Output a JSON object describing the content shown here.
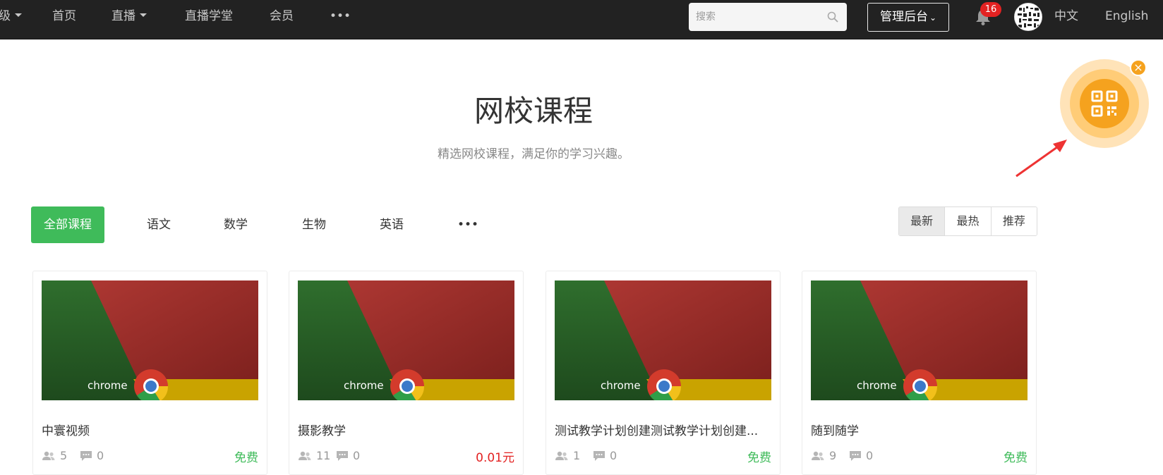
{
  "nav": {
    "partial_label": "级",
    "items": [
      {
        "label": "首页"
      },
      {
        "label": "直播"
      },
      {
        "label": "直播学堂"
      },
      {
        "label": "会员"
      },
      {
        "label": "•••"
      }
    ],
    "search": {
      "placeholder": "搜索",
      "value": ""
    },
    "admin_label": "管理后台",
    "notification_count": "16",
    "lang_zh": "中文",
    "lang_en": "English"
  },
  "header": {
    "title": "网校课程",
    "subtitle": "精选网校课程，满足你的学习兴趣。"
  },
  "categories": [
    {
      "label": "全部课程"
    },
    {
      "label": "语文"
    },
    {
      "label": "数学"
    },
    {
      "label": "生物"
    },
    {
      "label": "英语"
    },
    {
      "label": "•••"
    }
  ],
  "sort": {
    "options": [
      "最新",
      "最热",
      "推荐"
    ],
    "selected": "最新"
  },
  "courses": [
    {
      "title": "中寰视频",
      "students": "5",
      "comments": "0",
      "price": "免费",
      "thumb_text": "chrome"
    },
    {
      "title": "摄影教学",
      "students": "11",
      "comments": "0",
      "price": "0.01元",
      "thumb_text": "chrome"
    },
    {
      "title": "测试教学计划创建测试教学计划创建...",
      "students": "1",
      "comments": "0",
      "price": "免费",
      "thumb_text": "chrome"
    },
    {
      "title": "随到随学",
      "students": "9",
      "comments": "0",
      "price": "免费",
      "thumb_text": "chrome"
    }
  ],
  "colors": {
    "accent_green": "#3fbb5a",
    "price_red": "#e32222",
    "qr_orange": "#f5a21e",
    "topbar": "#222222"
  },
  "icons": {
    "search": "search-icon",
    "bell": "bell-icon",
    "qr": "qrcode-icon",
    "close": "close-icon",
    "users": "users-icon",
    "comment": "comment-icon"
  }
}
